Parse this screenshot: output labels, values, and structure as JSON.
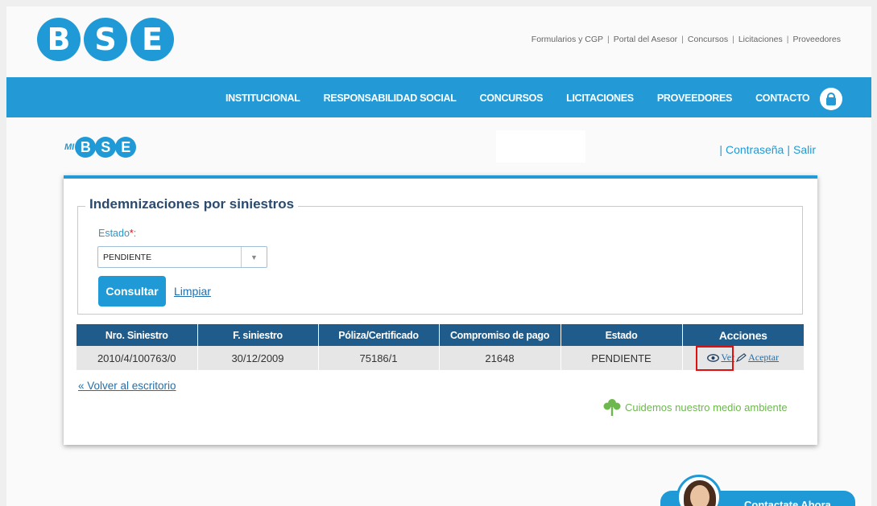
{
  "header": {
    "logo_letters": [
      "B",
      "S",
      "E"
    ],
    "top_links": [
      "Formularios y CGP",
      "Portal del Asesor",
      "Concursos",
      "Licitaciones",
      "Proveedores"
    ],
    "nav_items": [
      "INSTITUCIONAL",
      "RESPONSABILIDAD SOCIAL",
      "CONCURSOS",
      "LICITACIONES",
      "PROVEEDORES",
      "CONTACTO"
    ],
    "lock_icon": "lock-icon"
  },
  "mibse": {
    "prefix": "MI",
    "letters": [
      "B",
      "S",
      "E"
    ],
    "links": [
      "Contraseña",
      "Salir"
    ]
  },
  "form": {
    "legend": "Indemnizaciones por siniestros",
    "estado_label": "Estado",
    "required_mark": "*",
    "estado_colon": ":",
    "estado_value": "PENDIENTE",
    "consultar_label": "Consultar",
    "limpiar_label": "Limpiar"
  },
  "table": {
    "headers": [
      "Nro. Siniestro",
      "F. siniestro",
      "Póliza/Certificado",
      "Compromiso de pago",
      "Estado",
      "Acciones"
    ],
    "rows": [
      {
        "nro": "2010/4/100763/0",
        "fecha": "30/12/2009",
        "poliza": "75186/1",
        "compromiso": "21648",
        "estado": "PENDIENTE",
        "ver": "Ver",
        "aceptar": "Aceptar"
      }
    ]
  },
  "volver_label": "« Volver al escritorio",
  "eco_label": "Cuidemos nuestro medio ambiente",
  "contact_label": "Contactate Ahora",
  "colors": {
    "primary": "#2399d5",
    "table_header": "#1f5c8b",
    "highlight": "#e01010",
    "eco": "#6db84e"
  }
}
